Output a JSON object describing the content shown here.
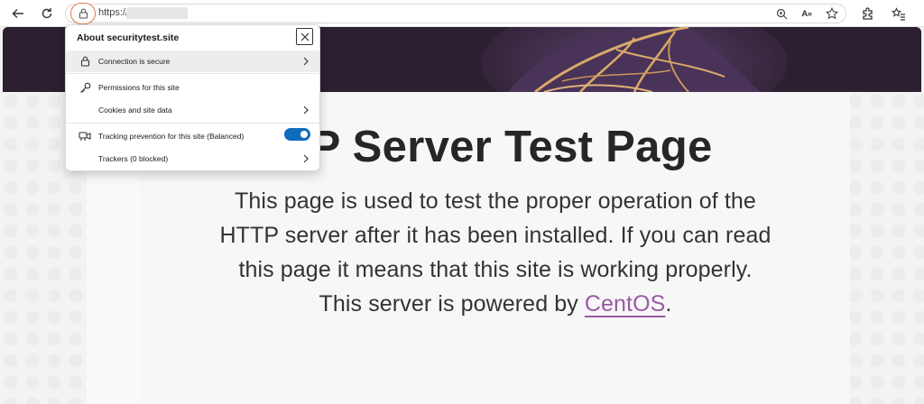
{
  "browser": {
    "url_prefix": "https://",
    "icons": [
      "back-arrow-icon",
      "refresh-icon",
      "lock-icon",
      "zoom-icon",
      "read-aloud-icon",
      "favorite-star-icon",
      "extensions-icon",
      "favorites-icon"
    ],
    "read_aloud_label": "A»"
  },
  "popup": {
    "title": "About securitytest.site",
    "rows": [
      {
        "label": "Connection is secure",
        "icon": "lock-icon",
        "has_chevron": true
      },
      {
        "label": "Permissions for this site",
        "icon": "key-icon",
        "has_chevron": false
      },
      {
        "label": "Cookies and site data",
        "icon": "",
        "has_chevron": true
      },
      {
        "label": "Tracking prevention for this site (Balanced)",
        "icon": "tracking-icon",
        "toggle_on": true
      },
      {
        "label": "Trackers (0 blocked)",
        "icon": "",
        "has_chevron": true
      }
    ]
  },
  "page": {
    "title": "HTTP Server Test Page",
    "body_lines": [
      "This page is used to test the proper operation of the",
      "HTTP server after it has been installed. If you can read",
      "this page it means that this site is working properly.",
      "This server is powered by "
    ],
    "link_text": "CentOS",
    "trailing": "."
  },
  "colors": {
    "accent": "#0f6cbd",
    "link": "#9a5aa4",
    "lock_ring": "#e07b45",
    "hero": "#2b1f30"
  }
}
